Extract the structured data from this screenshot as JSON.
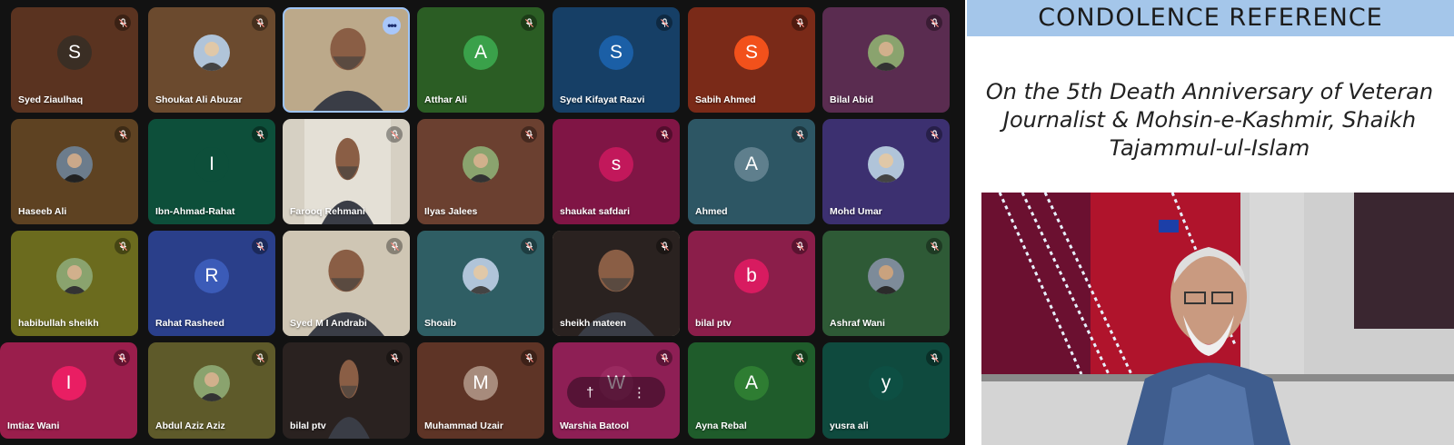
{
  "participants": [
    {
      "name": "Syed Ziaulhaq",
      "initial": "S",
      "kind": "initial",
      "avatar_color": "#3a2e24",
      "tile_color": "#5a3320"
    },
    {
      "name": "Shoukat Ali Abuzar",
      "kind": "photo",
      "tile_color": "#6b4a2e"
    },
    {
      "name": "",
      "kind": "video",
      "tile_color": "#d8d6cf",
      "active": true
    },
    {
      "name": "Atthar Ali",
      "initial": "A",
      "kind": "initial",
      "avatar_color": "#3aa14a",
      "tile_color": "#2b5d24"
    },
    {
      "name": "Syed Kifayat Razvi",
      "initial": "S",
      "kind": "initial",
      "avatar_color": "#1b5fa6",
      "tile_color": "#163f66"
    },
    {
      "name": "Sabih Ahmed",
      "initial": "S",
      "kind": "initial",
      "avatar_color": "#f2511b",
      "tile_color": "#7a2a18"
    },
    {
      "name": "Bilal Abid",
      "kind": "photo",
      "tile_color": "#5a2c50"
    },
    {
      "name": "Haseeb Ali",
      "kind": "photo",
      "tile_color": "#5e4222"
    },
    {
      "name": "Ibn-Ahmad-Rahat",
      "initial": "I",
      "kind": "initial",
      "avatar_color": "#0d4f3a",
      "tile_color": "#0d4f3a"
    },
    {
      "name": "Farooq Rehmani",
      "kind": "video",
      "tile_color": "#d6d0c3"
    },
    {
      "name": "Ilyas Jalees",
      "kind": "photo",
      "tile_color": "#6b4030"
    },
    {
      "name": "shaukat safdari",
      "initial": "s",
      "kind": "initial",
      "avatar_color": "#c2185b",
      "tile_color": "#801545"
    },
    {
      "name": "Ahmed",
      "initial": "A",
      "kind": "initial",
      "avatar_color": "#5f7f8d",
      "tile_color": "#2d5664"
    },
    {
      "name": "Mohd Umar",
      "kind": "photo",
      "tile_color": "#3c3070"
    },
    {
      "name": "habibullah sheikh",
      "kind": "photo",
      "tile_color": "#6b6b1e"
    },
    {
      "name": "Rahat Rasheed",
      "initial": "R",
      "kind": "initial",
      "avatar_color": "#3b5bb8",
      "tile_color": "#2a3f8a"
    },
    {
      "name": "Syed M I Andrabi",
      "kind": "video",
      "tile_color": "#c9c3b6"
    },
    {
      "name": "Shoaib",
      "kind": "photo",
      "tile_color": "#2f5e64"
    },
    {
      "name": "sheikh mateen",
      "kind": "video",
      "tile_color": "#b9a88a"
    },
    {
      "name": "bilal ptv",
      "initial": "b",
      "kind": "initial",
      "avatar_color": "#d81b60",
      "tile_color": "#8b1e4a"
    },
    {
      "name": "Ashraf Wani",
      "kind": "photo",
      "tile_color": "#2e5a36"
    },
    {
      "name": "Imtiaz Wani",
      "initial": "I",
      "kind": "initial",
      "avatar_color": "#e91e63",
      "tile_color": "#9a1e4c"
    },
    {
      "name": "Abdul Aziz Aziz",
      "kind": "photo",
      "tile_color": "#5e5a2a"
    },
    {
      "name": "bilal ptv",
      "kind": "video",
      "tile_color": "#2a2220"
    },
    {
      "name": "Muhammad Uzair",
      "initial": "M",
      "kind": "initial",
      "avatar_color": "#a78b7c",
      "tile_color": "#5e3426"
    },
    {
      "name": "Warshia Batool",
      "initial": "W",
      "kind": "initial",
      "avatar_color": "#9a2a60",
      "tile_color": "#8e1f55",
      "hover": true
    },
    {
      "name": "Ayna Rebal",
      "initial": "A",
      "kind": "initial",
      "avatar_color": "#2e7d32",
      "tile_color": "#1f5c2b"
    },
    {
      "name": "yusra ali",
      "initial": "y",
      "kind": "initial",
      "avatar_color": "#0d4f43",
      "tile_color": "#0f4a3e"
    }
  ],
  "icons": {
    "mic_off": "mic-off-icon",
    "more": "more-options-icon",
    "pin": "pin-icon",
    "overflow": "overflow-menu-icon"
  },
  "slide": {
    "header": "CONDOLENCE   REFERENCE",
    "line1": "On the 5th Death Anniversary of Veteran",
    "line2": "Journalist & Mohsin-e-Kashmir, Shaikh",
    "line3": "Tajammul-ul-Islam",
    "header_color": "#a4c6ea"
  },
  "hover_controls": {
    "pin_label": "↕",
    "more_label": "⋮"
  }
}
